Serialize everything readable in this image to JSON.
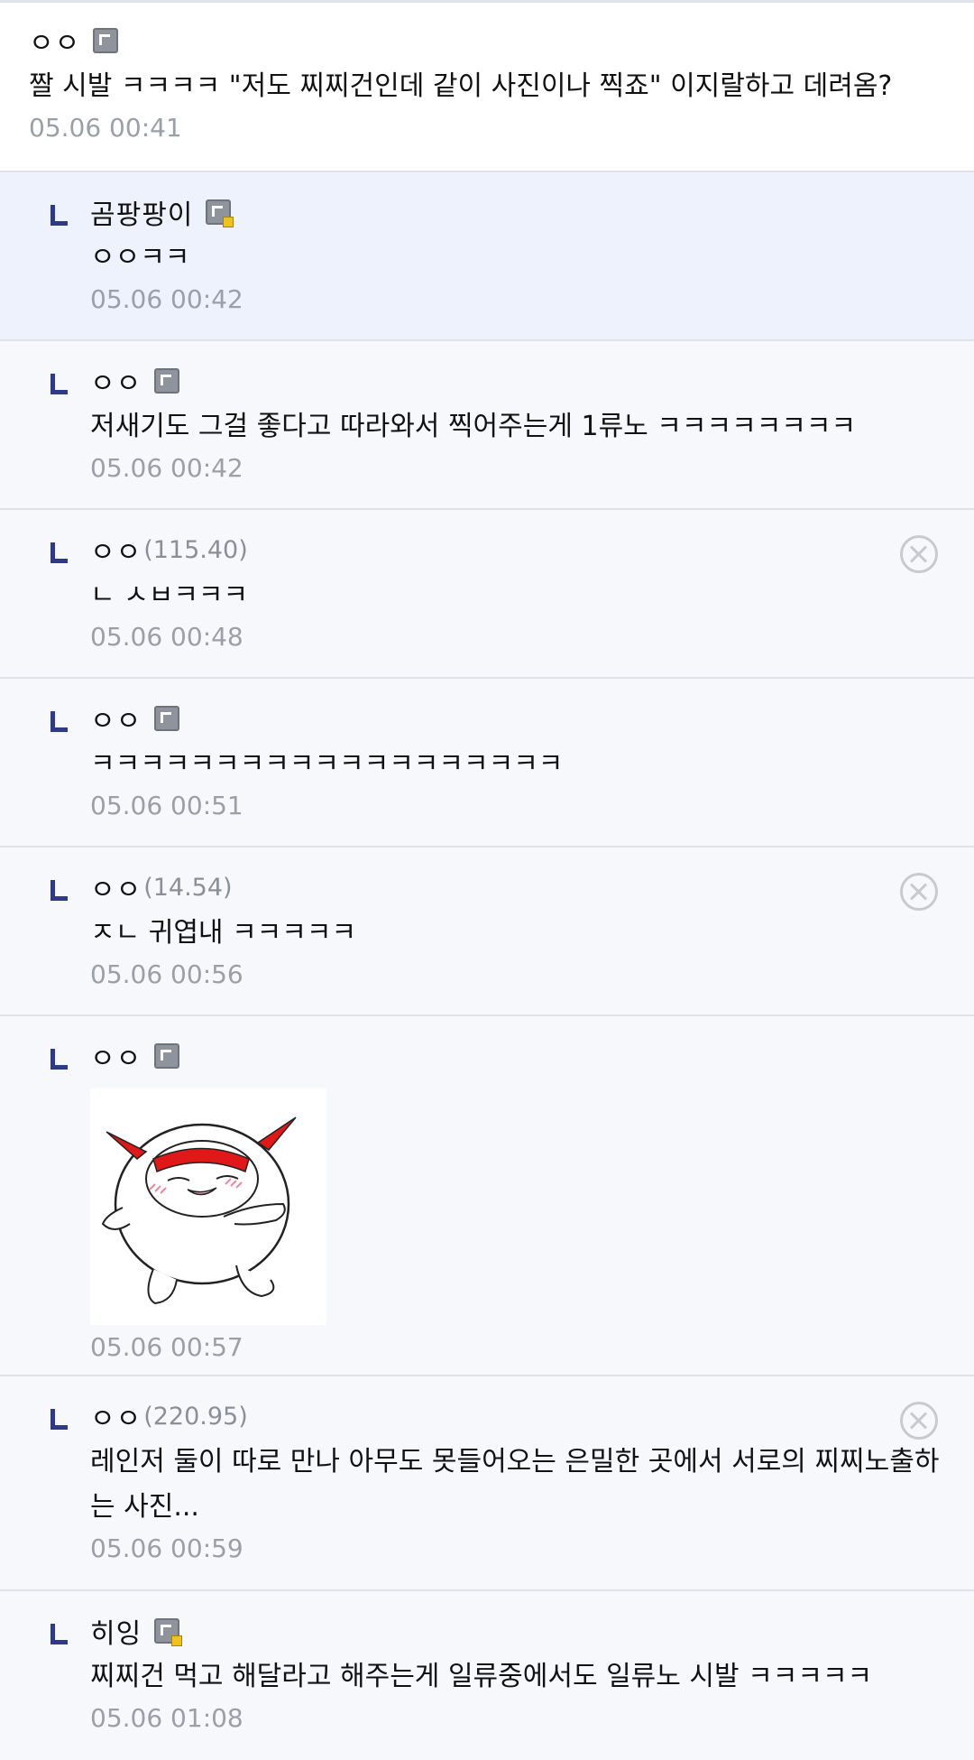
{
  "comments": [
    {
      "nick": "ㅇㅇ",
      "text": "짤 시발 ㅋㅋㅋㅋ \"저도 찌찌건인데 같이 사진이나 찍죠\" 이지랄하고 데려옴?",
      "time": "05.06 00:41"
    },
    {
      "nick": "곰팡팡이",
      "text": "ㅇㅇㅋㅋ",
      "time": "05.06 00:42"
    },
    {
      "nick": "ㅇㅇ",
      "text": "저새기도 그걸 좋다고 따라와서 찍어주는게 1류노 ㅋㅋㅋㅋㅋㅋㅋㅋ",
      "time": "05.06 00:42"
    },
    {
      "nick": "ㅇㅇ",
      "ip": "(115.40)",
      "text": "ㄴ ㅅㅂㅋㅋㅋ",
      "time": "05.06 00:48"
    },
    {
      "nick": "ㅇㅇ",
      "text": "ㅋㅋㅋㅋㅋㅋㅋㅋㅋㅋㅋㅋㅋㅋㅋㅋㅋㅋㅋ",
      "time": "05.06 00:51"
    },
    {
      "nick": "ㅇㅇ",
      "ip": "(14.54)",
      "text": "ㅈㄴ 귀엽내 ㅋㅋㅋㅋㅋ",
      "time": "05.06 00:56"
    },
    {
      "nick": "ㅇㅇ",
      "time": "05.06 00:57"
    },
    {
      "nick": "ㅇㅇ",
      "ip": "(220.95)",
      "text": "레인저 둘이 따로 만나 아무도 못들어오는 은밀한 곳에서 서로의 찌찌노출하는 사진...",
      "time": "05.06 00:59"
    },
    {
      "nick": "히잉",
      "text": "찌찌건 먹고 해달라고 해주는게 일류중에서도 일류노 시발 ㅋㅋㅋㅋㅋ",
      "time": "05.06 01:08"
    }
  ],
  "colors": {
    "accent": "#2e3a87",
    "highlight": "#eef2fc",
    "meta": "#9a9fa8"
  },
  "icons": {
    "member_badge": "fixed-nick-icon",
    "delete": "delete-circle-x-icon",
    "reply": "reply-arrow-icon"
  }
}
